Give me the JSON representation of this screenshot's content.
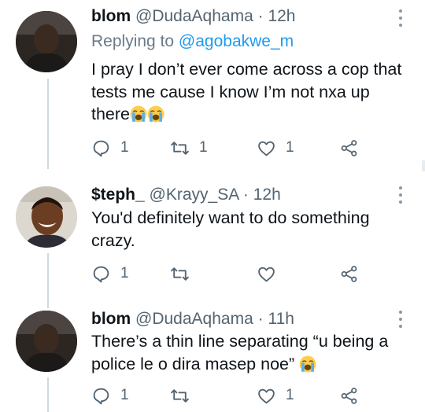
{
  "tweets": [
    {
      "name": "blom",
      "handle": "@DudaAqhama",
      "separator": "·",
      "time": "12h",
      "replying_prefix": "Replying to",
      "replying_handle": "@agobakwe_m",
      "text_line1": "I pray I don’t ever come across a cop that",
      "text_line2": "tests me cause I know I’m not nxa up",
      "text_line3": "there",
      "emoji": "crying-face",
      "emoji_count": 2,
      "reply_count": "1",
      "retweet_count": "1",
      "like_count": "1"
    },
    {
      "name": "$teph_",
      "handle": "@Krayy_SA",
      "separator": "·",
      "time": "12h",
      "text_line1": "You'd definitely want to do something",
      "text_line2": "crazy.",
      "reply_count": "1",
      "retweet_count": "",
      "like_count": ""
    },
    {
      "name": "blom",
      "handle": "@DudaAqhama",
      "separator": "·",
      "time": "11h",
      "text_line1": "There’s a thin line separating “u being a",
      "text_line2": "police le o dira masep noe”",
      "emoji": "crying-face",
      "emoji_count": 1,
      "reply_count": "1",
      "retweet_count": "",
      "like_count": "1"
    }
  ],
  "colors": {
    "text": "#0f1419",
    "secondary": "#536471",
    "link": "#1d9bf0",
    "thread_line": "#cfd9de"
  },
  "icons": [
    "reply-icon",
    "retweet-icon",
    "like-icon",
    "share-icon",
    "more-icon",
    "crying-face-emoji"
  ]
}
